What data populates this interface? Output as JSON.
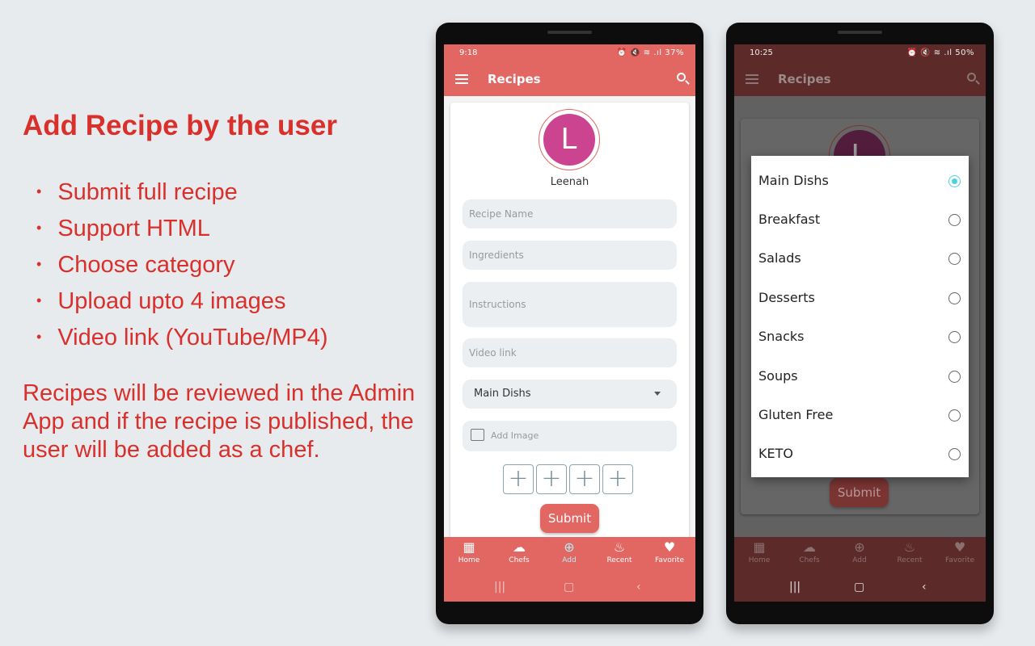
{
  "promo": {
    "title": "Add Recipe by the user",
    "bullets": [
      "Submit full recipe",
      "Support HTML",
      "Choose category",
      "Upload upto 4 images",
      "Video link (YouTube/MP4)"
    ],
    "note": "Recipes will be reviewed in the Admin App and if the recipe is published, the user will be added as a chef."
  },
  "colors": {
    "accent": "#e26763",
    "text_red": "#d9302c",
    "radio_selected": "#4dd0e1",
    "avatar": "#cc4490"
  },
  "phone1": {
    "time": "9:18",
    "status_icons": "⏰ 🔇 ≋ .ıl 37%",
    "title": "Recipes",
    "user": {
      "initial": "L",
      "name": "Leenah"
    },
    "fields": {
      "recipe_name": "Recipe Name",
      "ingredients": "Ingredients",
      "instructions": "Instructions",
      "video_link": "Video link",
      "category": "Main Dishs",
      "add_image": "Add Image"
    },
    "image_slots": [
      "+",
      "+",
      "+",
      "+"
    ],
    "submit": "Submit"
  },
  "nav": [
    {
      "label": "Home",
      "icon": "grid-icon"
    },
    {
      "label": "Chefs",
      "icon": "chef-hat-icon"
    },
    {
      "label": "Add",
      "icon": "plus-circle-icon"
    },
    {
      "label": "Recent",
      "icon": "flame-icon"
    },
    {
      "label": "Favorite",
      "icon": "heart-icon"
    }
  ],
  "phone2": {
    "time": "10:25",
    "status_icons": "⏰ 🔇 ≋ .ıl 50%",
    "title": "Recipes",
    "submit": "Submit",
    "categories": [
      {
        "label": "Main Dishs",
        "selected": true
      },
      {
        "label": "Breakfast"
      },
      {
        "label": "Salads"
      },
      {
        "label": "Desserts"
      },
      {
        "label": "Snacks"
      },
      {
        "label": "Soups"
      },
      {
        "label": "Gluten Free"
      },
      {
        "label": "KETO"
      }
    ]
  }
}
